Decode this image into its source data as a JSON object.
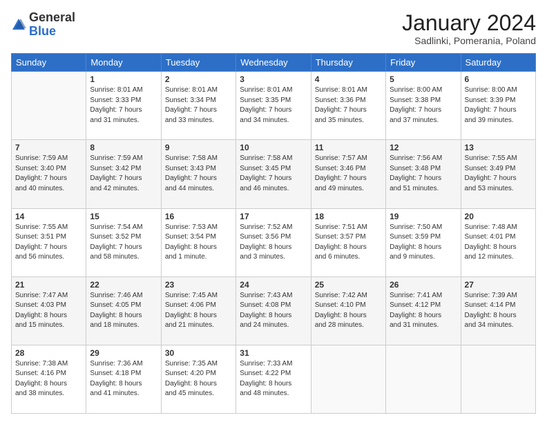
{
  "logo": {
    "general": "General",
    "blue": "Blue"
  },
  "header": {
    "month": "January 2024",
    "location": "Sadlinki, Pomerania, Poland"
  },
  "weekdays": [
    "Sunday",
    "Monday",
    "Tuesday",
    "Wednesday",
    "Thursday",
    "Friday",
    "Saturday"
  ],
  "weeks": [
    [
      {
        "day": "",
        "info": ""
      },
      {
        "day": "1",
        "info": "Sunrise: 8:01 AM\nSunset: 3:33 PM\nDaylight: 7 hours\nand 31 minutes."
      },
      {
        "day": "2",
        "info": "Sunrise: 8:01 AM\nSunset: 3:34 PM\nDaylight: 7 hours\nand 33 minutes."
      },
      {
        "day": "3",
        "info": "Sunrise: 8:01 AM\nSunset: 3:35 PM\nDaylight: 7 hours\nand 34 minutes."
      },
      {
        "day": "4",
        "info": "Sunrise: 8:01 AM\nSunset: 3:36 PM\nDaylight: 7 hours\nand 35 minutes."
      },
      {
        "day": "5",
        "info": "Sunrise: 8:00 AM\nSunset: 3:38 PM\nDaylight: 7 hours\nand 37 minutes."
      },
      {
        "day": "6",
        "info": "Sunrise: 8:00 AM\nSunset: 3:39 PM\nDaylight: 7 hours\nand 39 minutes."
      }
    ],
    [
      {
        "day": "7",
        "info": "Sunrise: 7:59 AM\nSunset: 3:40 PM\nDaylight: 7 hours\nand 40 minutes."
      },
      {
        "day": "8",
        "info": "Sunrise: 7:59 AM\nSunset: 3:42 PM\nDaylight: 7 hours\nand 42 minutes."
      },
      {
        "day": "9",
        "info": "Sunrise: 7:58 AM\nSunset: 3:43 PM\nDaylight: 7 hours\nand 44 minutes."
      },
      {
        "day": "10",
        "info": "Sunrise: 7:58 AM\nSunset: 3:45 PM\nDaylight: 7 hours\nand 46 minutes."
      },
      {
        "day": "11",
        "info": "Sunrise: 7:57 AM\nSunset: 3:46 PM\nDaylight: 7 hours\nand 49 minutes."
      },
      {
        "day": "12",
        "info": "Sunrise: 7:56 AM\nSunset: 3:48 PM\nDaylight: 7 hours\nand 51 minutes."
      },
      {
        "day": "13",
        "info": "Sunrise: 7:55 AM\nSunset: 3:49 PM\nDaylight: 7 hours\nand 53 minutes."
      }
    ],
    [
      {
        "day": "14",
        "info": "Sunrise: 7:55 AM\nSunset: 3:51 PM\nDaylight: 7 hours\nand 56 minutes."
      },
      {
        "day": "15",
        "info": "Sunrise: 7:54 AM\nSunset: 3:52 PM\nDaylight: 7 hours\nand 58 minutes."
      },
      {
        "day": "16",
        "info": "Sunrise: 7:53 AM\nSunset: 3:54 PM\nDaylight: 8 hours\nand 1 minute."
      },
      {
        "day": "17",
        "info": "Sunrise: 7:52 AM\nSunset: 3:56 PM\nDaylight: 8 hours\nand 3 minutes."
      },
      {
        "day": "18",
        "info": "Sunrise: 7:51 AM\nSunset: 3:57 PM\nDaylight: 8 hours\nand 6 minutes."
      },
      {
        "day": "19",
        "info": "Sunrise: 7:50 AM\nSunset: 3:59 PM\nDaylight: 8 hours\nand 9 minutes."
      },
      {
        "day": "20",
        "info": "Sunrise: 7:48 AM\nSunset: 4:01 PM\nDaylight: 8 hours\nand 12 minutes."
      }
    ],
    [
      {
        "day": "21",
        "info": "Sunrise: 7:47 AM\nSunset: 4:03 PM\nDaylight: 8 hours\nand 15 minutes."
      },
      {
        "day": "22",
        "info": "Sunrise: 7:46 AM\nSunset: 4:05 PM\nDaylight: 8 hours\nand 18 minutes."
      },
      {
        "day": "23",
        "info": "Sunrise: 7:45 AM\nSunset: 4:06 PM\nDaylight: 8 hours\nand 21 minutes."
      },
      {
        "day": "24",
        "info": "Sunrise: 7:43 AM\nSunset: 4:08 PM\nDaylight: 8 hours\nand 24 minutes."
      },
      {
        "day": "25",
        "info": "Sunrise: 7:42 AM\nSunset: 4:10 PM\nDaylight: 8 hours\nand 28 minutes."
      },
      {
        "day": "26",
        "info": "Sunrise: 7:41 AM\nSunset: 4:12 PM\nDaylight: 8 hours\nand 31 minutes."
      },
      {
        "day": "27",
        "info": "Sunrise: 7:39 AM\nSunset: 4:14 PM\nDaylight: 8 hours\nand 34 minutes."
      }
    ],
    [
      {
        "day": "28",
        "info": "Sunrise: 7:38 AM\nSunset: 4:16 PM\nDaylight: 8 hours\nand 38 minutes."
      },
      {
        "day": "29",
        "info": "Sunrise: 7:36 AM\nSunset: 4:18 PM\nDaylight: 8 hours\nand 41 minutes."
      },
      {
        "day": "30",
        "info": "Sunrise: 7:35 AM\nSunset: 4:20 PM\nDaylight: 8 hours\nand 45 minutes."
      },
      {
        "day": "31",
        "info": "Sunrise: 7:33 AM\nSunset: 4:22 PM\nDaylight: 8 hours\nand 48 minutes."
      },
      {
        "day": "",
        "info": ""
      },
      {
        "day": "",
        "info": ""
      },
      {
        "day": "",
        "info": ""
      }
    ]
  ]
}
